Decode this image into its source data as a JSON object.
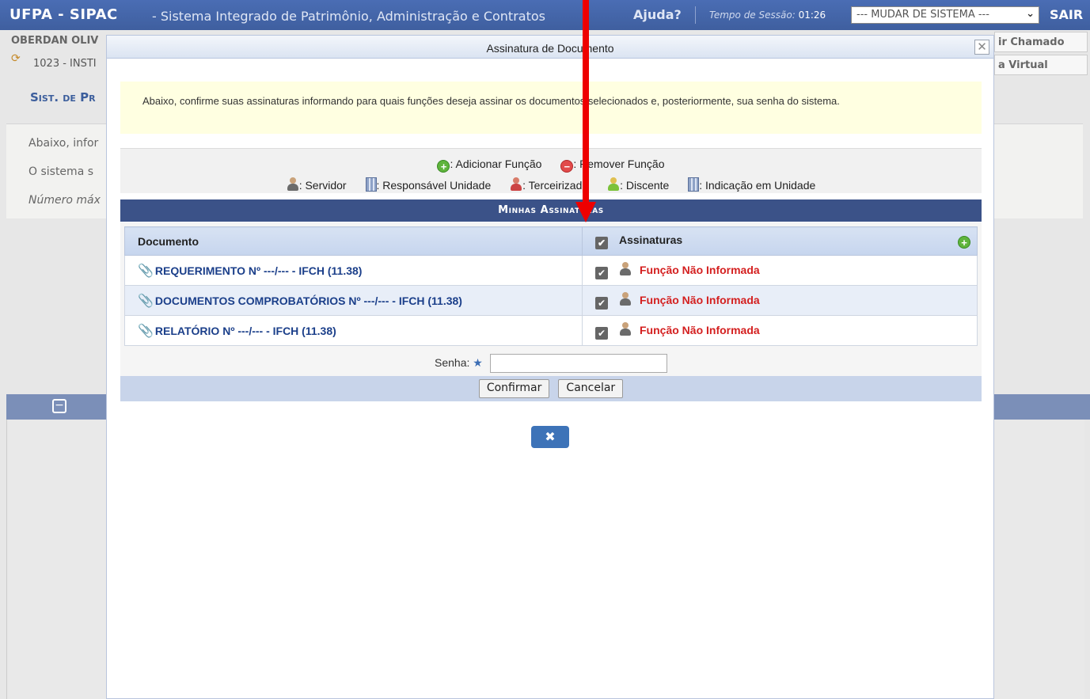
{
  "header": {
    "brand": "UFPA - SIPAC",
    "system_name": "- Sistema Integrado de Patrimônio, Administração e Contratos",
    "help_label": "Ajuda?",
    "session_label": "Tempo de Sessão:",
    "session_value": "01:26",
    "system_select_value": "--- MUDAR DE SISTEMA ---",
    "logout_label": "SAIR"
  },
  "background": {
    "user_name": "OBERDAN OLIV",
    "unit": "1023 - INSTI",
    "system_link": "Sist. de Pr",
    "right_button_1": "ir Chamado",
    "right_button_2": "a Virtual",
    "line_1": "Abaixo, infor",
    "line_2": "O sistema s",
    "line_3": "Número máx"
  },
  "modal": {
    "title": "Assinatura de Documento",
    "close_glyph": "✕",
    "notice": "Abaixo, confirme suas assinaturas informando para quais funções deseja assinar os documentos selecionados e, posteriormente, sua senha do sistema.",
    "legend": {
      "add_function": ": Adicionar Função",
      "remove_function": ": Remover Função",
      "server": ": Servidor",
      "unit_responsible": ": Responsável Unidade",
      "outsourced": ": Terceirizado",
      "student": ": Discente",
      "unit_indication": ": Indicação em Unidade"
    },
    "section_title": "Minhas Assinaturas",
    "table": {
      "col_document": "Documento",
      "col_signatures": "Assinaturas",
      "rows": [
        {
          "document": "REQUERIMENTO Nº ---/--- - IFCH (11.38)",
          "function": "Função Não Informada"
        },
        {
          "document": "DOCUMENTOS COMPROBATÓRIOS Nº ---/--- - IFCH (11.38)",
          "function": "Função Não Informada"
        },
        {
          "document": "RELATÓRIO Nº ---/--- - IFCH (11.38)",
          "function": "Função Não Informada"
        }
      ]
    },
    "password_label": "Senha:",
    "password_value": "",
    "confirm_label": "Confirmar",
    "cancel_label": "Cancelar",
    "close_button_glyph": "✖"
  },
  "colors": {
    "header_blue": "#3f5f9f",
    "section_title_bg": "#3b5288",
    "function_text": "#d42020",
    "annotation_arrow": "#e00000"
  }
}
